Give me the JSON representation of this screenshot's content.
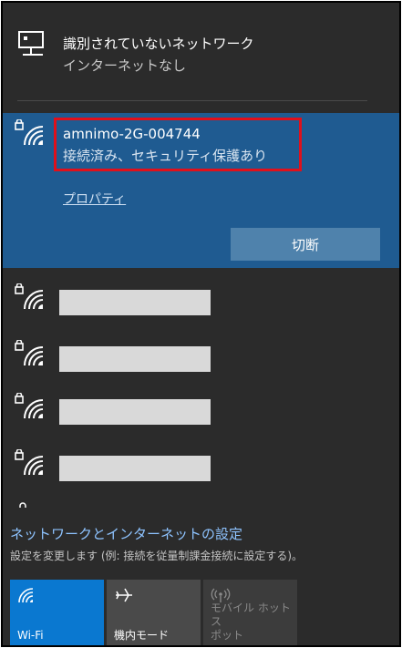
{
  "ethernet": {
    "title": "識別されていないネットワーク",
    "status": "インターネットなし",
    "icon": "ethernet-icon"
  },
  "connected_network": {
    "name": "amnimo-2G-004744",
    "status": "接続済み、セキュリティ保護あり",
    "properties_label": "プロパティ",
    "disconnect_label": "切断",
    "icon": "wifi-secured-icon",
    "highlight_color": "#1f5b91",
    "annotation_color": "#e0101b"
  },
  "networks": [
    {
      "icon": "wifi-secured-icon"
    },
    {
      "icon": "wifi-secured-icon"
    },
    {
      "icon": "wifi-secured-icon"
    },
    {
      "icon": "wifi-secured-icon"
    }
  ],
  "settings": {
    "link_label": "ネットワークとインターネットの設定",
    "description": "設定を変更します (例: 接続を従量制課金接続に設定する)。"
  },
  "quick_actions": {
    "wifi": {
      "label": "Wi-Fi",
      "icon": "wifi-icon",
      "active": true
    },
    "airplane": {
      "label": "機内モード",
      "icon": "airplane-icon",
      "active": false
    },
    "hotspot": {
      "line1": "モバイル ホットス",
      "line2": "ポット",
      "icon": "hotspot-icon",
      "enabled": false
    }
  },
  "colors": {
    "panel_bg": "#2b2b2b",
    "accent": "#0a78d0",
    "link": "#8ec3ff"
  }
}
